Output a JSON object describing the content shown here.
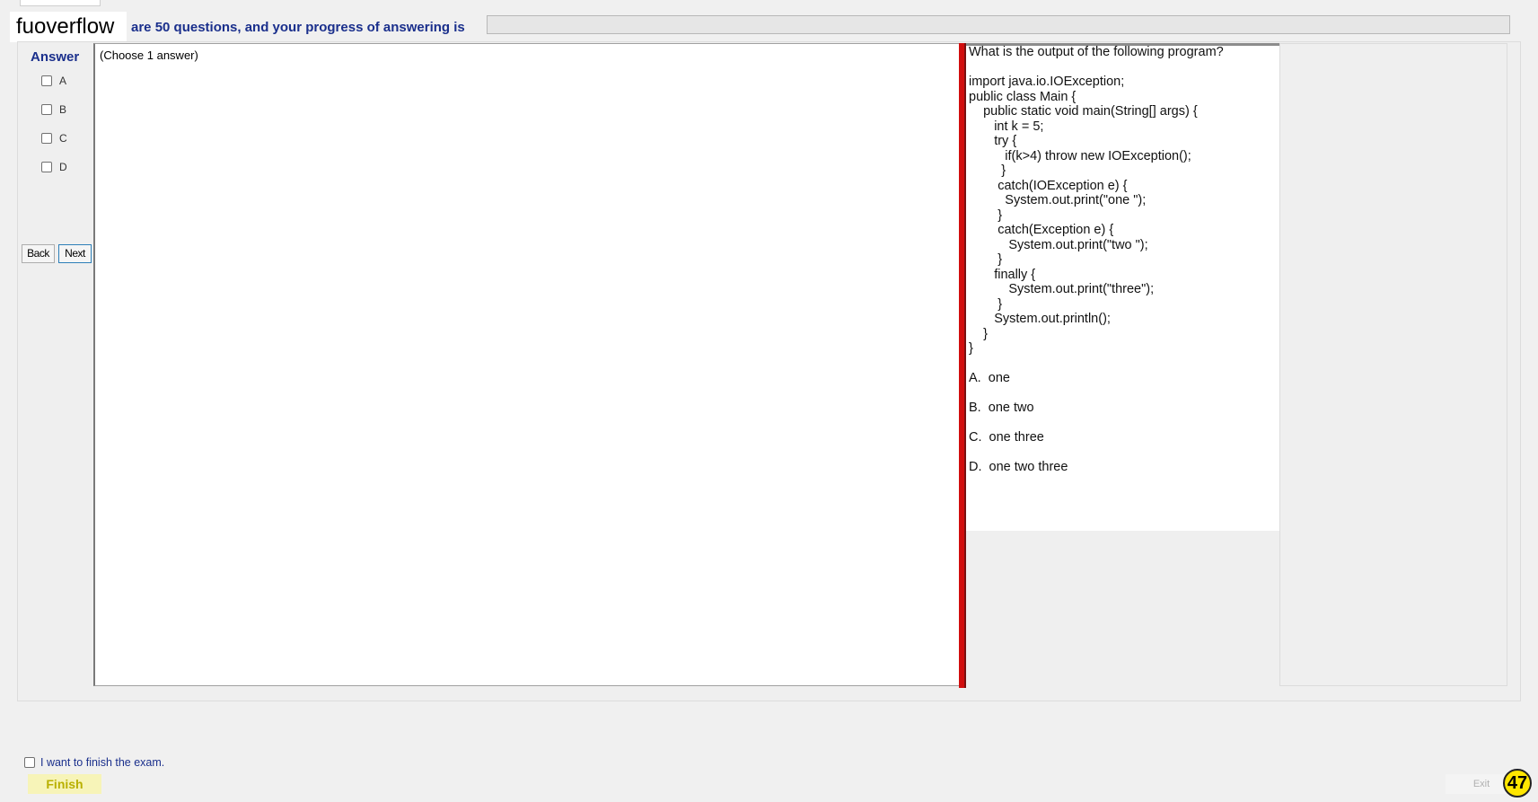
{
  "header": {
    "brand": "fuoverflow",
    "progress_text": "are 50 questions, and your progress of answering is",
    "progress_fraction": 0
  },
  "answer_panel": {
    "title": "Answer",
    "options": [
      "A",
      "B",
      "C",
      "D"
    ],
    "back_label": "Back",
    "next_label": "Next"
  },
  "main": {
    "choose_text": "(Choose 1 answer)"
  },
  "question": {
    "text": "What is the output of the following program?\n\nimport java.io.IOException;\npublic class Main {\n    public static void main(String[] args) {\n       int k = 5;\n       try {\n          if(k>4) throw new IOException();\n         }\n        catch(IOException e) {\n          System.out.print(\"one \");\n        }\n        catch(Exception e) {\n           System.out.print(\"two \");\n        }\n       finally {\n           System.out.print(\"three\");\n        }\n       System.out.println();\n    }\n}\n\nA.  one\n\nB.  one two\n\nC.  one three\n\nD.  one two three"
  },
  "footer": {
    "finish_check_label": "I want to finish the exam.",
    "finish_label": "Finish",
    "exit_label": "Exit",
    "badge": "47"
  },
  "colors": {
    "accent_blue": "#1a2f8c",
    "divider_red": "#d10e0e",
    "finish_yellow": "#f7f4b8",
    "badge_yellow": "#ffe600"
  }
}
